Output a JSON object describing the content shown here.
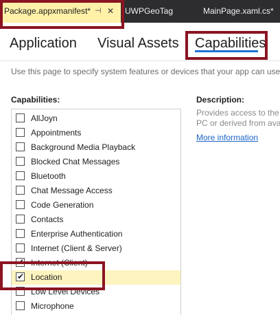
{
  "doc_tabs": {
    "active": {
      "label": "Package.appxmanifest*",
      "pin_icon": "pin-icon",
      "close_icon": "close-icon"
    },
    "others": [
      {
        "label": "UWPGeoTag"
      },
      {
        "label": "MainPage.xaml.cs*"
      }
    ]
  },
  "page_tabs": [
    "Application",
    "Visual Assets",
    "Capabilities"
  ],
  "intro": "Use this page to specify system features or devices that your app can use.",
  "capabilities_heading": "Capabilities:",
  "description_heading": "Description:",
  "description_lines": [
    "Provides access to the c",
    "PC or derived from ava"
  ],
  "more_information": "More information",
  "capabilities": [
    {
      "label": "AllJoyn",
      "checked": false
    },
    {
      "label": "Appointments",
      "checked": false
    },
    {
      "label": "Background Media Playback",
      "checked": false
    },
    {
      "label": "Blocked Chat Messages",
      "checked": false
    },
    {
      "label": "Bluetooth",
      "checked": false
    },
    {
      "label": "Chat Message Access",
      "checked": false
    },
    {
      "label": "Code Generation",
      "checked": false
    },
    {
      "label": "Contacts",
      "checked": false
    },
    {
      "label": "Enterprise Authentication",
      "checked": false
    },
    {
      "label": "Internet (Client & Server)",
      "checked": false
    },
    {
      "label": "Internet (Client)",
      "checked": true
    },
    {
      "label": "Location",
      "checked": true,
      "selected": true
    },
    {
      "label": "Low Level Devices",
      "checked": false
    },
    {
      "label": "Microphone",
      "checked": false
    }
  ],
  "colors": {
    "highlight_box": "#8b1423",
    "active_tab": "#fff1a8",
    "tab_strip": "#2d2d30",
    "selected_row": "#fdf4bf",
    "accent": "#1e73d6",
    "link": "#1c64c8"
  }
}
